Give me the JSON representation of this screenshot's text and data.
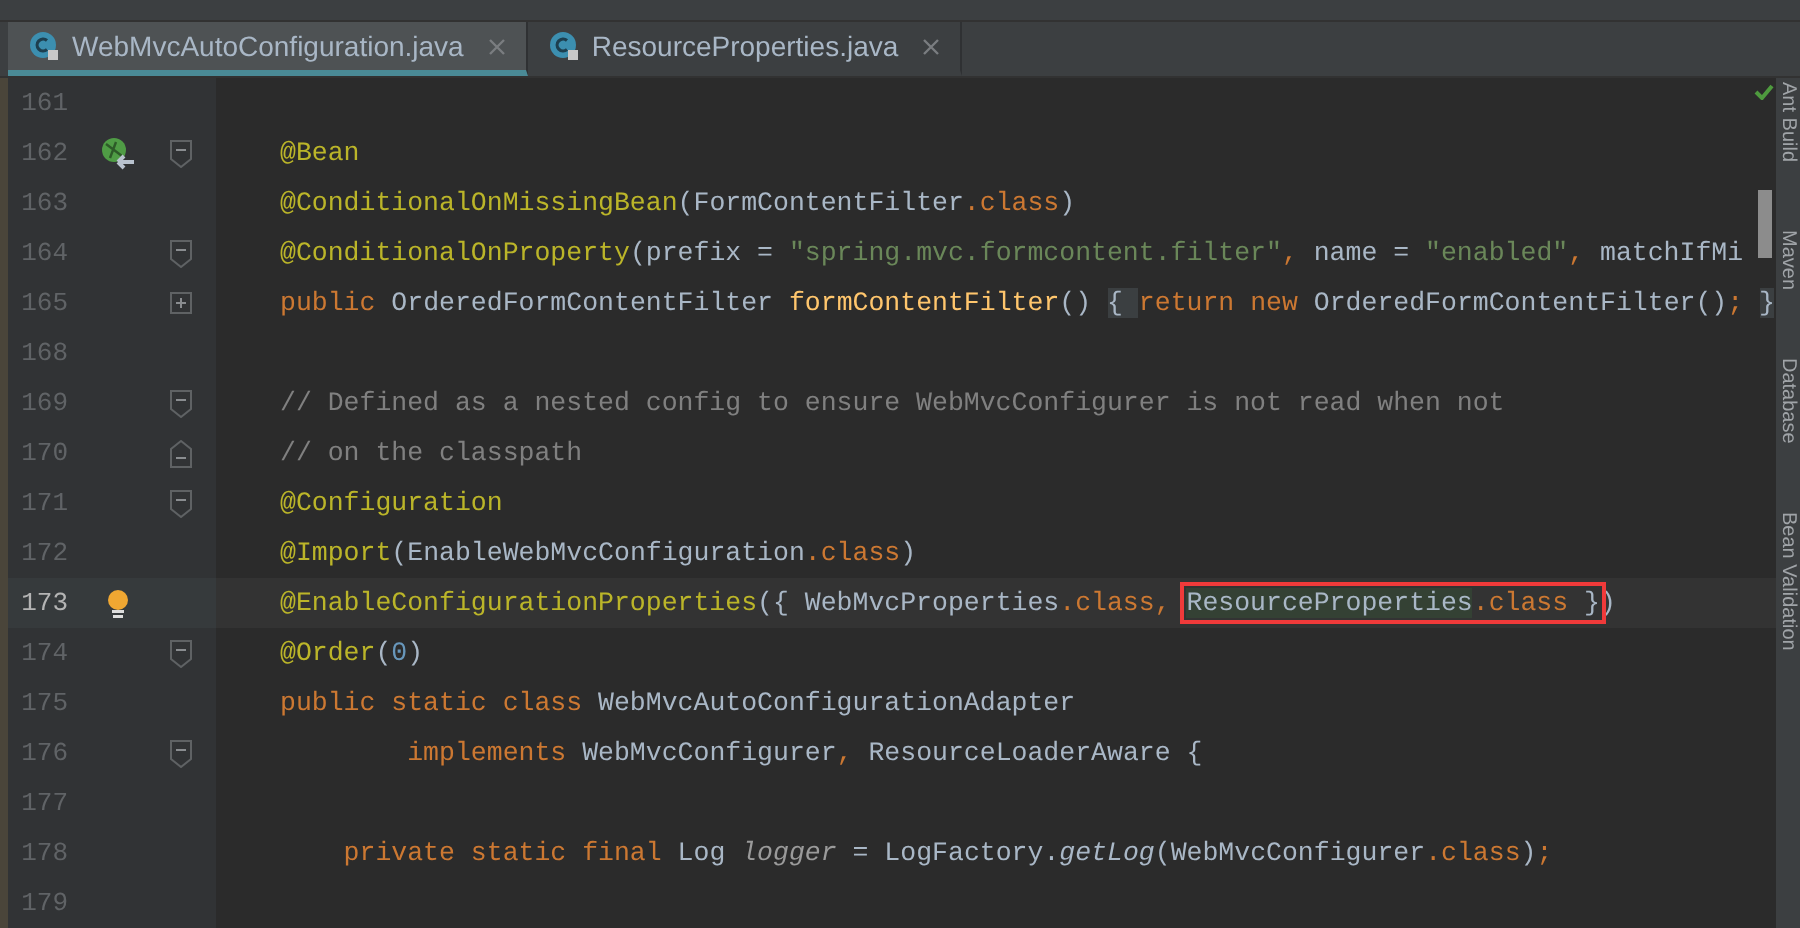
{
  "tabs": [
    {
      "label": "WebMvcAutoConfiguration.java",
      "selected": true
    },
    {
      "label": "ResourceProperties.java",
      "selected": false
    }
  ],
  "editor": {
    "lines": [
      {
        "number": "161",
        "current": false
      },
      {
        "number": "162",
        "current": false,
        "markers": [
          {
            "kind": "bean"
          },
          {
            "kind": "foldstart"
          }
        ],
        "segments": [
          {
            "kind": "ann",
            "text": "@Bean"
          }
        ]
      },
      {
        "number": "163",
        "current": false,
        "segments": [
          {
            "kind": "ann",
            "text": "@ConditionalOnMissingBean"
          },
          {
            "kind": "plain",
            "text": "(FormContentFilter"
          },
          {
            "kind": "kw",
            "text": ".class"
          },
          {
            "kind": "plain",
            "text": ")"
          }
        ]
      },
      {
        "number": "164",
        "current": false,
        "markers": [
          {
            "kind": "foldstart"
          }
        ],
        "segments": [
          {
            "kind": "ann",
            "text": "@ConditionalOnProperty"
          },
          {
            "kind": "plain",
            "text": "(prefix = "
          },
          {
            "kind": "str",
            "text": "\"spring.mvc.formcontent.filter\""
          },
          {
            "kind": "kw",
            "text": ", "
          },
          {
            "kind": "plain",
            "text": "name = "
          },
          {
            "kind": "str",
            "text": "\"enabled\""
          },
          {
            "kind": "kw",
            "text": ", "
          },
          {
            "kind": "plain",
            "text": "matchIfMi"
          }
        ]
      },
      {
        "number": "165",
        "current": false,
        "markers": [
          {
            "kind": "folded"
          }
        ],
        "segments": [
          {
            "kind": "kw",
            "text": "public "
          },
          {
            "kind": "plain",
            "text": "OrderedFormContentFilter "
          },
          {
            "kind": "fn",
            "text": "formContentFilter"
          },
          {
            "kind": "plain",
            "text": "() "
          },
          {
            "kind": "brace",
            "text": "{ "
          },
          {
            "kind": "kw",
            "text": "return new "
          },
          {
            "kind": "plain",
            "text": "OrderedFormContentFilter()"
          },
          {
            "kind": "kw",
            "text": "; "
          },
          {
            "kind": "brace",
            "text": "}"
          }
        ]
      },
      {
        "number": "168",
        "current": false
      },
      {
        "number": "169",
        "current": false,
        "markers": [
          {
            "kind": "foldstart"
          }
        ],
        "segments": [
          {
            "kind": "comment",
            "text": "// Defined as a nested config to ensure WebMvcConfigurer is not read when not"
          }
        ]
      },
      {
        "number": "170",
        "current": false,
        "markers": [
          {
            "kind": "foldend"
          }
        ],
        "segments": [
          {
            "kind": "comment",
            "text": "// on the classpath"
          }
        ]
      },
      {
        "number": "171",
        "current": false,
        "markers": [
          {
            "kind": "foldstart"
          }
        ],
        "segments": [
          {
            "kind": "ann",
            "text": "@Configuration"
          }
        ]
      },
      {
        "number": "172",
        "current": false,
        "segments": [
          {
            "kind": "ann",
            "text": "@Import"
          },
          {
            "kind": "plain",
            "text": "(EnableWebMvcConfiguration"
          },
          {
            "kind": "kw",
            "text": ".class"
          },
          {
            "kind": "plain",
            "text": ")"
          }
        ]
      },
      {
        "number": "173",
        "current": true,
        "markers": [
          {
            "kind": "bulb"
          }
        ],
        "segments": [
          {
            "kind": "ann",
            "text": "@EnableConfigurationProperties"
          },
          {
            "kind": "plain",
            "text": "({ WebMvcProperties"
          },
          {
            "kind": "kw",
            "text": ".class, "
          },
          {
            "kind": "box",
            "children": [
              {
                "kind": "ref",
                "text": "ResourceProperties"
              },
              {
                "kind": "kw",
                "text": ".class "
              },
              {
                "kind": "plain",
                "text": "}"
              }
            ]
          },
          {
            "kind": "plain",
            "text": ")"
          }
        ]
      },
      {
        "number": "174",
        "current": false,
        "markers": [
          {
            "kind": "foldstart"
          }
        ],
        "segments": [
          {
            "kind": "ann",
            "text": "@Order"
          },
          {
            "kind": "plain",
            "text": "("
          },
          {
            "kind": "num",
            "text": "0"
          },
          {
            "kind": "plain",
            "text": ")"
          }
        ]
      },
      {
        "number": "175",
        "current": false,
        "segments": [
          {
            "kind": "kw",
            "text": "public static class "
          },
          {
            "kind": "plain",
            "text": "WebMvcAutoConfigurationAdapter"
          }
        ]
      },
      {
        "number": "176",
        "current": false,
        "markers": [
          {
            "kind": "foldstart"
          }
        ],
        "segments": [
          {
            "kind": "kw",
            "text": "        implements "
          },
          {
            "kind": "plain",
            "text": "WebMvcConfigurer"
          },
          {
            "kind": "kw",
            "text": ", "
          },
          {
            "kind": "plain",
            "text": "ResourceLoaderAware {"
          }
        ]
      },
      {
        "number": "177",
        "current": false
      },
      {
        "number": "178",
        "current": false,
        "segments": [
          {
            "kind": "kw",
            "text": "    private static final "
          },
          {
            "kind": "plain",
            "text": "Log "
          },
          {
            "kind": "field",
            "text": "logger"
          },
          {
            "kind": "plain",
            "text": " = LogFactory."
          },
          {
            "kind": "smethod",
            "text": "getLog"
          },
          {
            "kind": "plain",
            "text": "(WebMvcConfigurer"
          },
          {
            "kind": "kw",
            "text": ".class"
          },
          {
            "kind": "plain",
            "text": ")"
          },
          {
            "kind": "kw",
            "text": ";"
          }
        ]
      },
      {
        "number": "179",
        "current": false
      }
    ]
  },
  "tool_windows": [
    "Ant Build",
    "Maven",
    "Database",
    "Bean Validation"
  ]
}
